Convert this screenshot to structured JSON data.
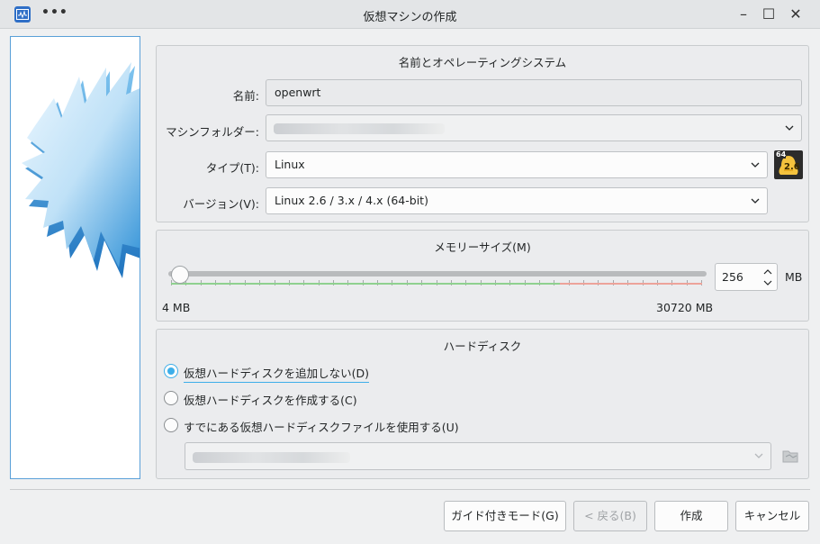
{
  "window": {
    "title": "仮想マシンの作成",
    "menu_dots": "•••",
    "minimize": "–",
    "maximize": "☐",
    "close": "✕"
  },
  "name_os": {
    "section_title": "名前とオペレーティングシステム",
    "name_label": "名前:",
    "name_value": "openwrt",
    "folder_label": "マシンフォルダー:",
    "type_label": "タイプ(T):",
    "type_value": "Linux",
    "version_label": "バージョン(V):",
    "version_value": "Linux 2.6 / 3.x / 4.x (64-bit)",
    "os_badge_text": "2.6",
    "os_badge_bits": "64"
  },
  "memory": {
    "section_title": "メモリーサイズ(M)",
    "min_label": "4 MB",
    "max_label": "30720 MB",
    "value": "256",
    "unit": "MB",
    "slider_fraction": 0.008
  },
  "hard_disk": {
    "section_title": "ハードディスク",
    "options": [
      {
        "label": "仮想ハードディスクを追加しない(D)",
        "checked": true
      },
      {
        "label": "仮想ハードディスクを作成する(C)",
        "checked": false
      },
      {
        "label": "すでにある仮想ハードディスクファイルを使用する(U)",
        "checked": false
      }
    ]
  },
  "buttons": {
    "guided": "ガイド付きモード(G)",
    "back": "< 戻る(B)",
    "create": "作成",
    "cancel": "キャンセル"
  },
  "colors": {
    "accent": "#3daee9",
    "graphic_blue": "#2f8fd8"
  },
  "icons": {
    "app": "virtualbox-icon",
    "os": "linux-os-icon",
    "folder": "folder-open-icon"
  }
}
